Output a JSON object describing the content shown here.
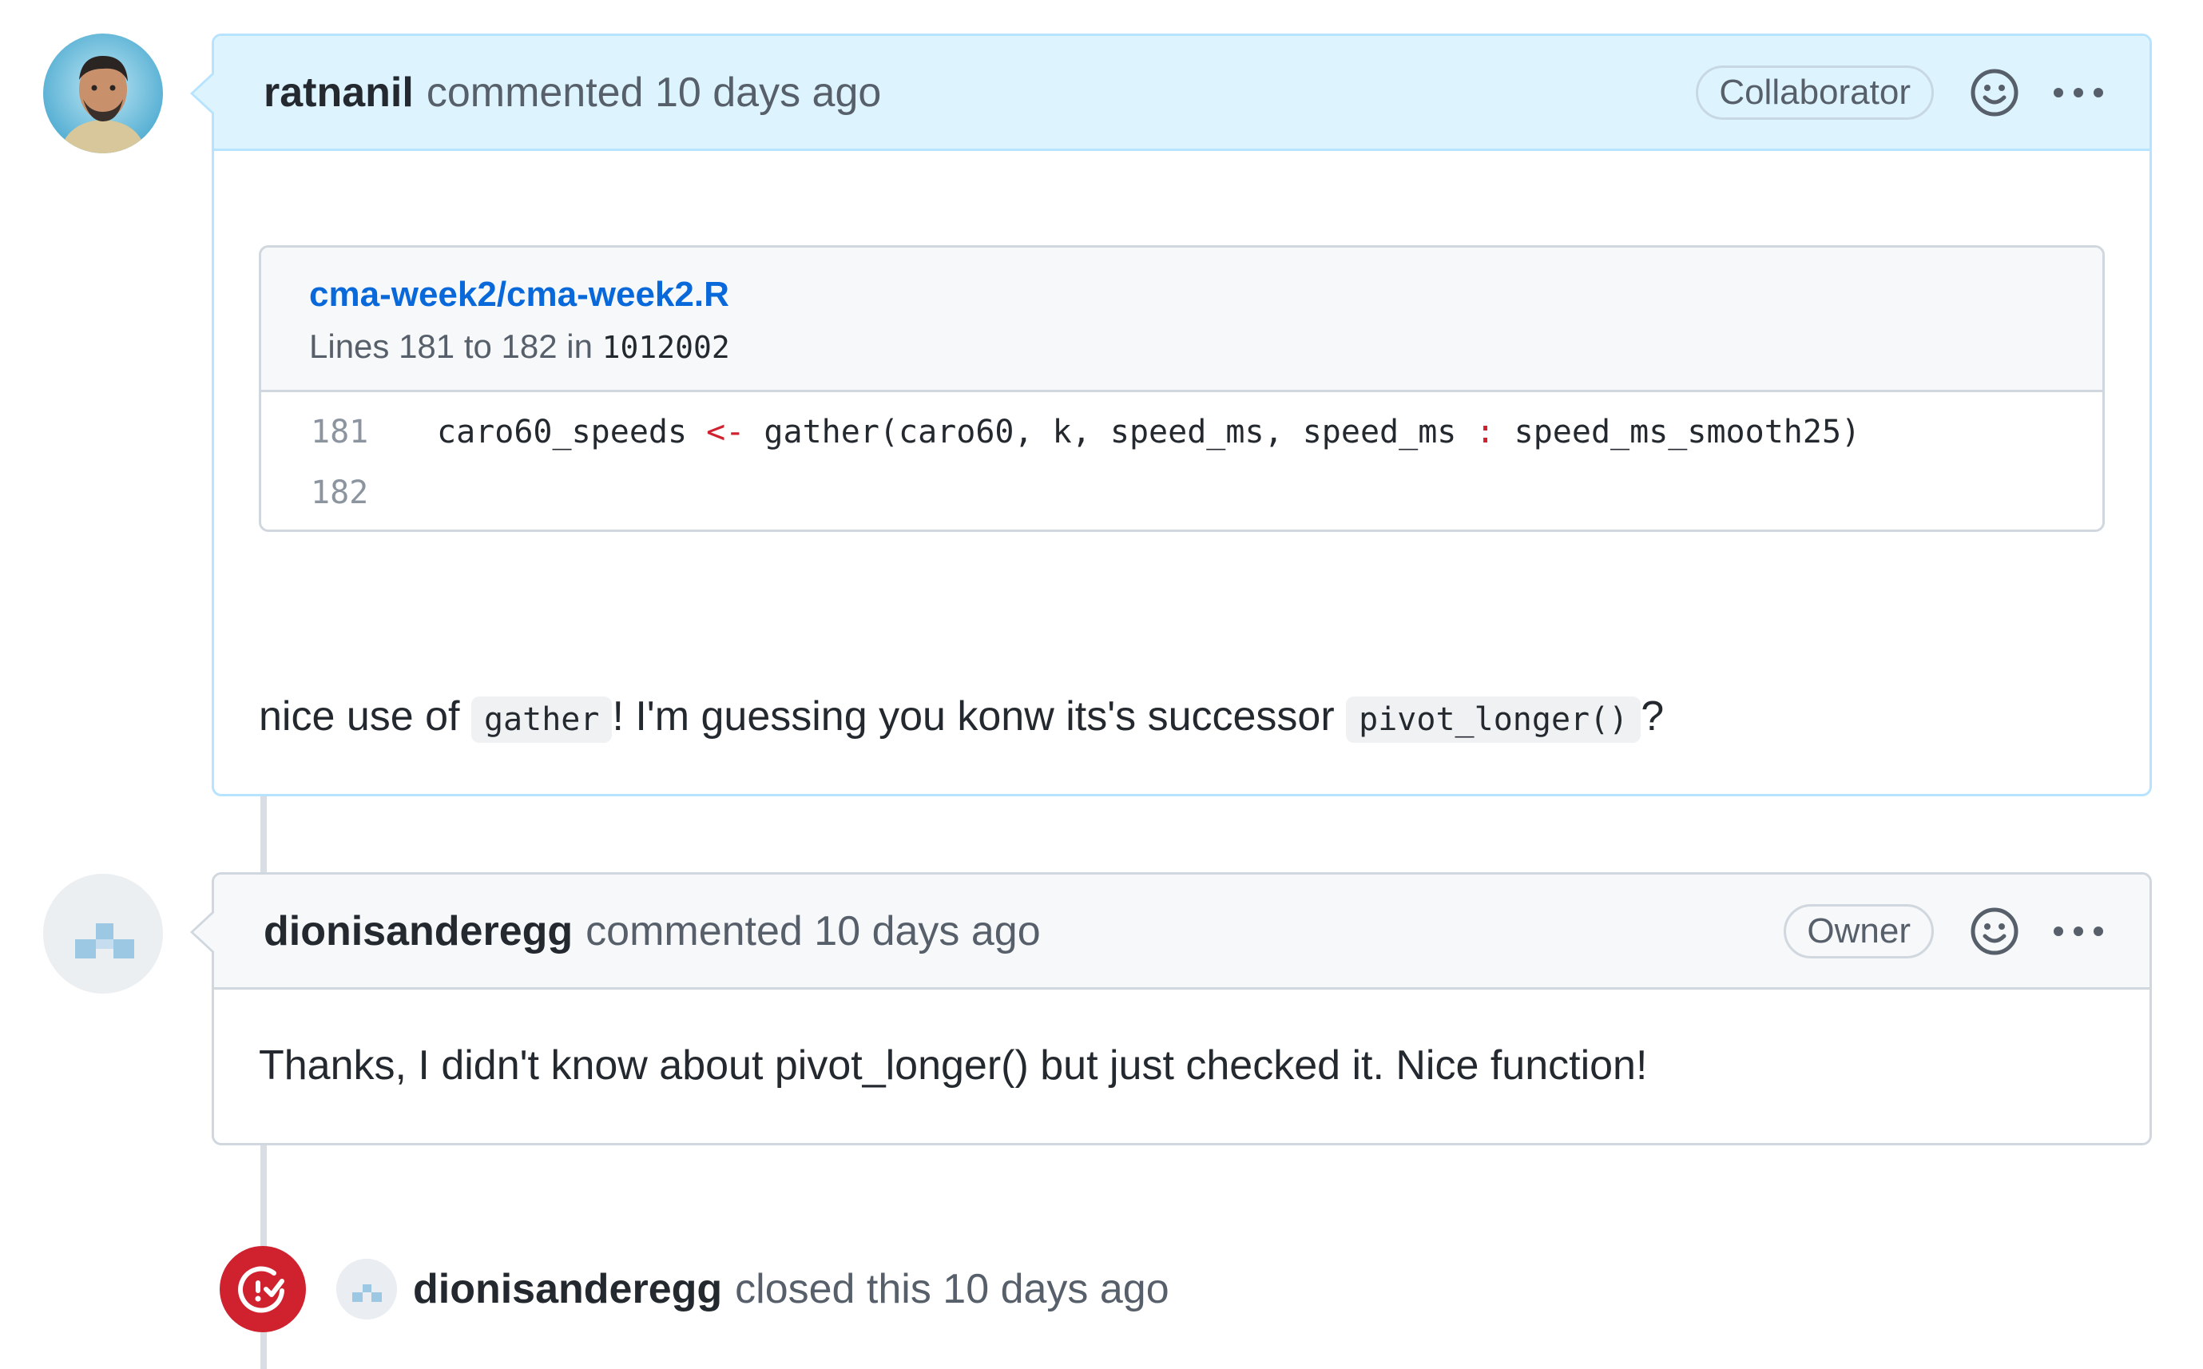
{
  "comments": [
    {
      "author": "ratnanil",
      "meta": "commented 10 days ago",
      "role_badge": "Collaborator",
      "snippet": {
        "file": "cma-week2/cma-week2.R",
        "lines_prefix": "Lines 181 to 182 in",
        "commit": "1012002",
        "rows": [
          {
            "num": "181",
            "code_a": "caro60_speeds ",
            "op1": "<-",
            "code_b": " gather(caro60, k, speed_ms, speed_ms ",
            "op2": ":",
            "code_c": " speed_ms_smooth25)"
          },
          {
            "num": "182"
          }
        ]
      },
      "message": {
        "part1": "nice use of ",
        "code1": "gather",
        "part2": "! I'm guessing you konw its's successor ",
        "code2": "pivot_longer()",
        "part3": "?"
      }
    },
    {
      "author": "dionisanderegg",
      "meta": "commented 10 days ago",
      "role_badge": "Owner",
      "message": "Thanks, I didn't know about pivot_longer() but just checked it. Nice function!"
    }
  ],
  "event": {
    "icon": "issue-closed-icon",
    "actor": "dionisanderegg",
    "text": "closed this 10 days ago",
    "color": "#cf222e"
  },
  "icons": {
    "reaction": "smiley-icon",
    "more": "kebab-horizontal-icon"
  }
}
